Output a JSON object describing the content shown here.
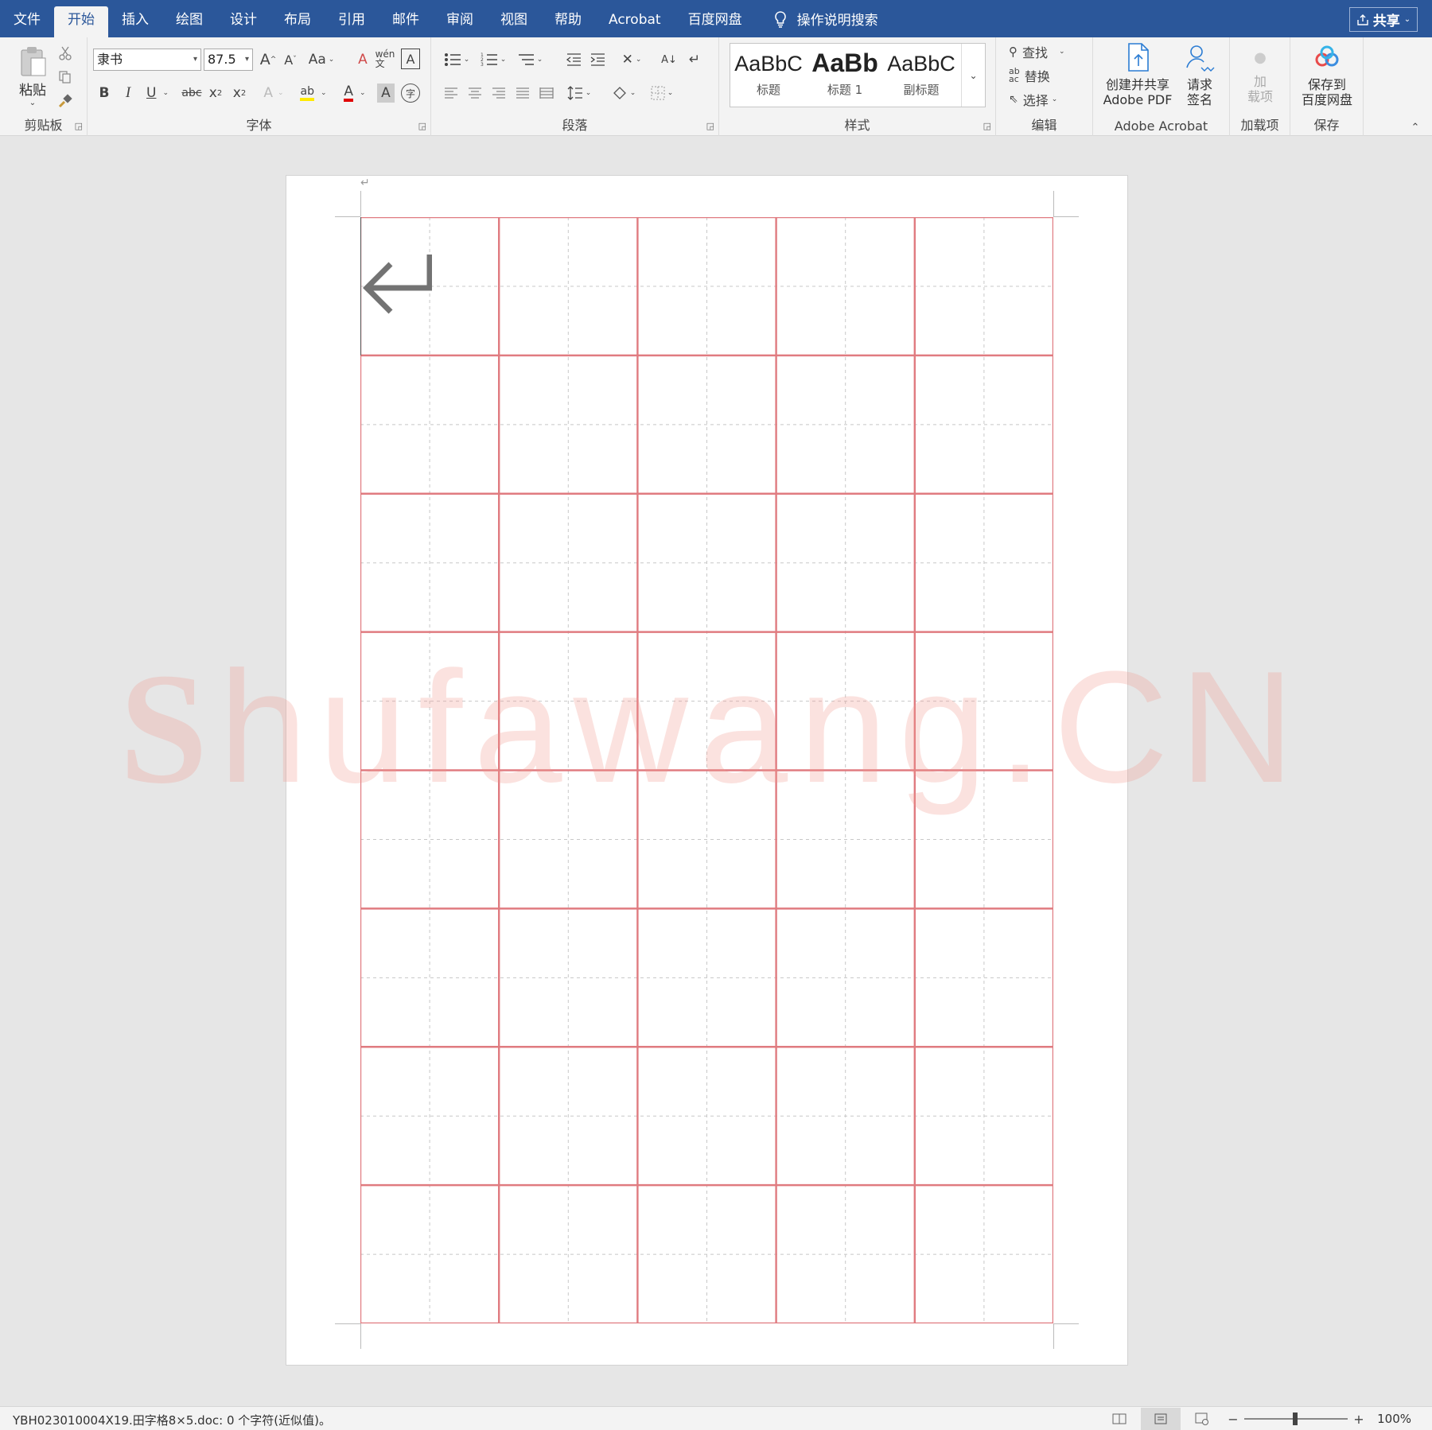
{
  "menu": {
    "tabs": [
      "文件",
      "开始",
      "插入",
      "绘图",
      "设计",
      "布局",
      "引用",
      "邮件",
      "审阅",
      "视图",
      "帮助",
      "Acrobat",
      "百度网盘"
    ],
    "tell_me": "操作说明搜索",
    "share": "共享"
  },
  "ribbon": {
    "clipboard": {
      "paste": "粘贴",
      "label": "剪贴板"
    },
    "font": {
      "name": "隶书",
      "size": "87.5",
      "aa": "Aa",
      "label": "字体"
    },
    "paragraph": {
      "label": "段落"
    },
    "styles": {
      "items": [
        {
          "preview": "AaBbC",
          "name": "标题"
        },
        {
          "preview": "AaBb",
          "name": "标题 1"
        },
        {
          "preview": "AaBbC",
          "name": "副标题"
        }
      ],
      "label": "样式"
    },
    "editing": {
      "find": "查找",
      "replace": "替换",
      "select": "选择",
      "label": "编辑"
    },
    "acrobat": {
      "create_line1": "创建并共享",
      "create_line2": "Adobe PDF",
      "sign_line1": "请求",
      "sign_line2": "签名",
      "label": "Adobe Acrobat"
    },
    "addins": {
      "line1": "加",
      "line2": "载项",
      "label": "加载项"
    },
    "save": {
      "line1": "保存到",
      "line2": "百度网盘",
      "label": "保存"
    }
  },
  "document": {
    "grid": {
      "columns": 5,
      "rows": 8,
      "type": "田字格",
      "line_color": "#e07b80"
    },
    "watermark": "Shufawang.CN"
  },
  "status": {
    "text": "YBH023010004X19.田字格8×5.doc: 0 个字符(近似值)。",
    "zoom": "100%"
  },
  "colors": {
    "title_bar": "#2b579a",
    "ribbon": "#f3f3f3",
    "grid": "#e07b80"
  }
}
